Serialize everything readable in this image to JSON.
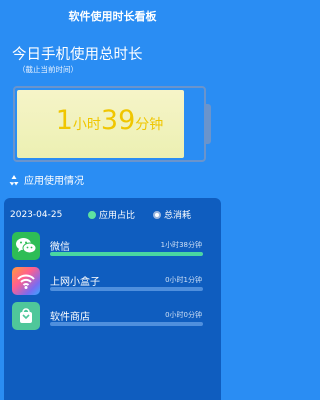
{
  "header": {
    "title": "软件使用时长看板"
  },
  "summary": {
    "headline": "今日手机使用总时长",
    "note": "（截止当前时间）",
    "hours": "1",
    "hour_unit": "小时",
    "minutes": "39",
    "minute_unit": "分钟",
    "battery_level": 0.9
  },
  "section": {
    "title": "应用使用情况",
    "icon": "recycle-icon"
  },
  "filter": {
    "date": "2023-04-25",
    "options": [
      {
        "label": "应用占比",
        "selected": true
      },
      {
        "label": "总消耗",
        "selected": false
      }
    ]
  },
  "apps": [
    {
      "name": "微信",
      "time": "1小时38分钟",
      "share": 1.0,
      "icon": "wechat-icon",
      "color": "#2ebd56"
    },
    {
      "name": "上网小盒子",
      "time": "0小时1分钟",
      "share": 0.0,
      "icon": "wifi-icon",
      "color": "#28b96c"
    },
    {
      "name": "软件商店",
      "time": "0小时0分钟",
      "share": 0.0,
      "icon": "store-icon",
      "color": "#4fc79a"
    }
  ],
  "colors": {
    "background": "#2a8df3",
    "card": "#0f5dbf",
    "accent_time": "#f0c600",
    "progress": "#49d6a1"
  }
}
